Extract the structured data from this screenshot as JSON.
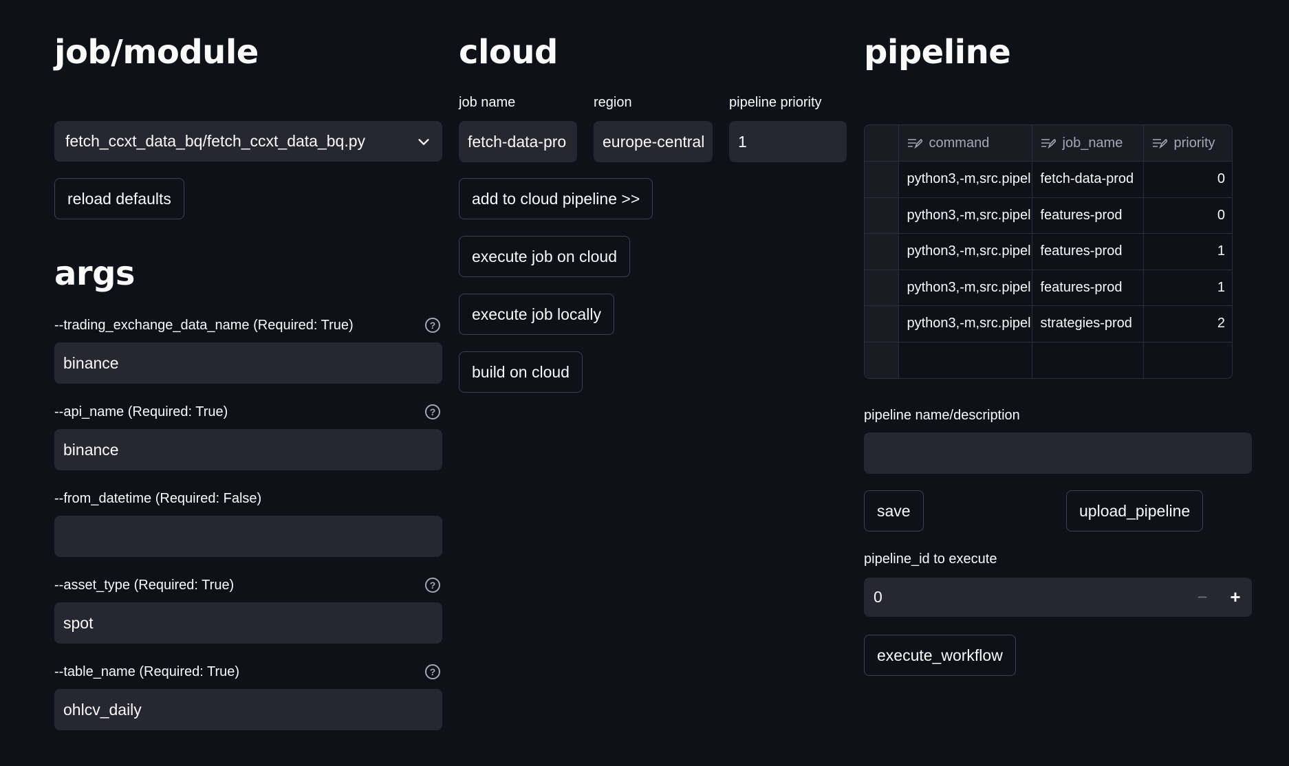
{
  "job_module": {
    "title": "job/module",
    "selected_module": "fetch_ccxt_data_bq/fetch_ccxt_data_bq.py",
    "reload_label": "reload defaults"
  },
  "args": {
    "title": "args",
    "fields": [
      {
        "label": "--trading_exchange_data_name (Required: True)",
        "value": "binance",
        "help": true
      },
      {
        "label": "--api_name (Required: True)",
        "value": "binance",
        "help": true
      },
      {
        "label": "--from_datetime (Required: False)",
        "value": "",
        "help": false
      },
      {
        "label": "--asset_type (Required: True)",
        "value": "spot",
        "help": true
      },
      {
        "label": "--table_name (Required: True)",
        "value": "ohlcv_daily",
        "help": true
      }
    ]
  },
  "cloud": {
    "title": "cloud",
    "job_name_label": "job name",
    "job_name_value": "fetch-data-pro",
    "region_label": "region",
    "region_value": "europe-central",
    "priority_label": "pipeline priority",
    "priority_value": "1",
    "buttons": {
      "add": "add to cloud pipeline >>",
      "exec_cloud": "execute job on cloud",
      "exec_local": "execute job locally",
      "build": "build on cloud"
    }
  },
  "pipeline": {
    "title": "pipeline",
    "columns": [
      "command",
      "job_name",
      "priority"
    ],
    "rows": [
      {
        "command": "python3,-m,src.pipel",
        "job_name": "fetch-data-prod",
        "priority": "0"
      },
      {
        "command": "python3,-m,src.pipel",
        "job_name": "features-prod",
        "priority": "0"
      },
      {
        "command": "python3,-m,src.pipel",
        "job_name": "features-prod",
        "priority": "1"
      },
      {
        "command": "python3,-m,src.pipel",
        "job_name": "features-prod",
        "priority": "1"
      },
      {
        "command": "python3,-m,src.pipel",
        "job_name": "strategies-prod",
        "priority": "2"
      }
    ],
    "name_label": "pipeline name/description",
    "name_value": "",
    "save_label": "save",
    "upload_label": "upload_pipeline",
    "id_label": "pipeline_id to execute",
    "id_value": "0",
    "execute_label": "execute_workflow"
  },
  "icons": {
    "select": "chevron-down-icon",
    "help": "question-circle-icon",
    "column_header": "edit-text-icon",
    "stepper_minus": "minus-icon",
    "stepper_plus": "plus-icon"
  },
  "colors": {
    "background": "#0e1117",
    "input_background": "#262730",
    "text": "#fafafa",
    "muted": "#a3a8b8",
    "border": "#3d4049"
  }
}
